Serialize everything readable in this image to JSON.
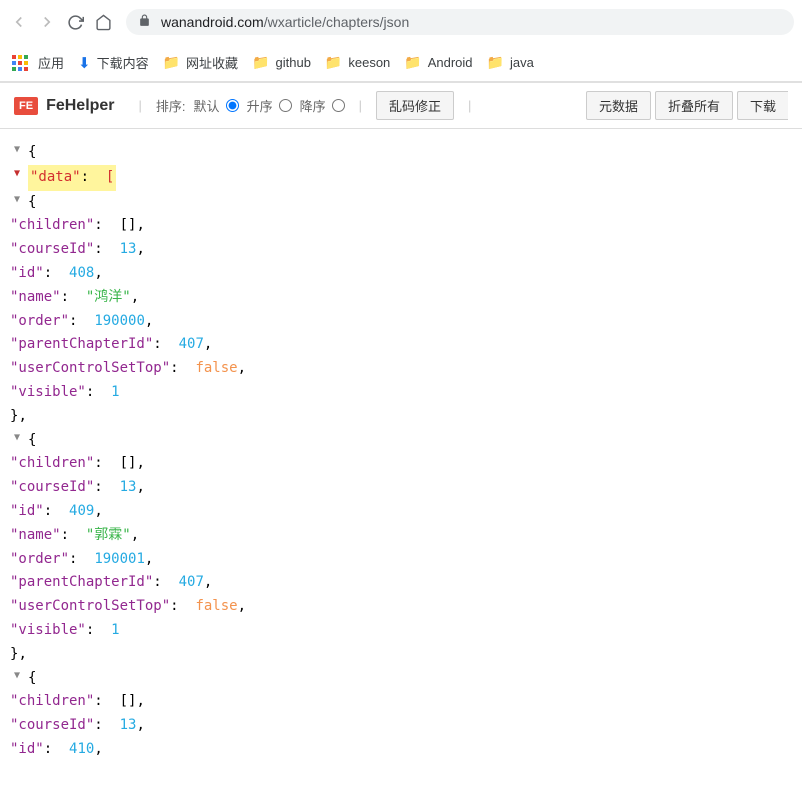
{
  "browser": {
    "url_domain": "wanandroid.com",
    "url_path": "/wxarticle/chapters/json"
  },
  "bookmarks": {
    "apps": "应用",
    "downloads": "下载内容",
    "folders": [
      "网址收藏",
      "github",
      "keeson",
      "Android",
      "java"
    ]
  },
  "toolbar": {
    "logo": "FE",
    "title": "FeHelper",
    "sort_label": "排序:",
    "sort_options": [
      "默认",
      "升序",
      "降序"
    ],
    "btn_fix": "乱码修正",
    "btn_raw": "元数据",
    "btn_collapse": "折叠所有",
    "btn_download": "下载"
  },
  "json": {
    "root_key": "\"data\"",
    "root_bracket": "[",
    "entries": [
      {
        "children": "[]",
        "courseId": 13,
        "id": 408,
        "name": "\"鸿洋\"",
        "order": 190000,
        "parentChapterId": 407,
        "userControlSetTop": "false",
        "visible": 1
      },
      {
        "children": "[]",
        "courseId": 13,
        "id": 409,
        "name": "\"郭霖\"",
        "order": 190001,
        "parentChapterId": 407,
        "userControlSetTop": "false",
        "visible": 1
      },
      {
        "children": "[]",
        "courseId": 13,
        "id": 410
      }
    ],
    "keys": {
      "children": "\"children\"",
      "courseId": "\"courseId\"",
      "id": "\"id\"",
      "name": "\"name\"",
      "order": "\"order\"",
      "parentChapterId": "\"parentChapterId\"",
      "userControlSetTop": "\"userControlSetTop\"",
      "visible": "\"visible\""
    }
  }
}
